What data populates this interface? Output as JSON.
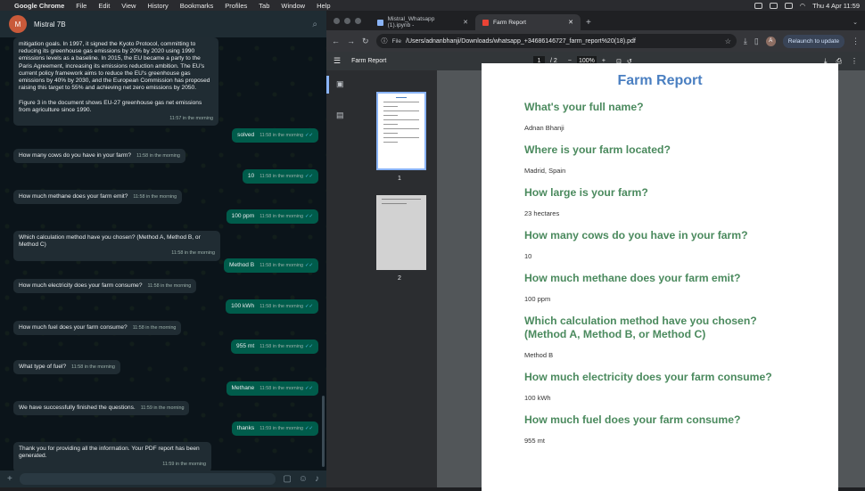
{
  "menubar": {
    "app": "Google Chrome",
    "items": [
      "File",
      "Edit",
      "View",
      "History",
      "Bookmarks",
      "Profiles",
      "Tab",
      "Window",
      "Help"
    ],
    "clock": "Thu 4 Apr  11:59"
  },
  "whatsapp": {
    "avatar_text": "M",
    "contact": "Mistral 7B",
    "messages": [
      {
        "dir": "in",
        "text": "mitigation goals. In 1997, it signed the Kyoto Protocol, committing to reducing its greenhouse gas emissions by 20% by 2020 using 1990 emissions levels as a baseline. In 2015, the EU became a party to the Paris Agreement, increasing its emissions reduction ambition. The EU's current policy framework aims to reduce the EU's greenhouse gas emissions by 40% by 2030, and the European Commission has proposed raising this target to 55% and achieving net zero emissions by 2050.\n\nFigure 3 in the document shows EU-27 greenhouse gas net emissions from agriculture since 1990.",
        "time": "11:57 in the morning"
      },
      {
        "dir": "out",
        "text": "solved",
        "time": "11:58 in the morning"
      },
      {
        "dir": "in",
        "text": "How many cows do you have in your farm?",
        "time": "11:58 in the morning"
      },
      {
        "dir": "out",
        "text": "10",
        "time": "11:58 in the morning"
      },
      {
        "dir": "in",
        "text": "How much methane does your farm emit?",
        "time": "11:58 in the morning"
      },
      {
        "dir": "out",
        "text": "100 ppm",
        "time": "11:58 in the morning"
      },
      {
        "dir": "in",
        "text": "Which calculation method have you chosen? (Method A, Method B, or Method C)",
        "time": "11:58 in the morning"
      },
      {
        "dir": "out",
        "text": "Method B",
        "time": "11:58 in the morning"
      },
      {
        "dir": "in",
        "text": "How much electricity does your farm consume?",
        "time": "11:58 in the morning"
      },
      {
        "dir": "out",
        "text": "100 kWh",
        "time": "11:58 in the morning"
      },
      {
        "dir": "in",
        "text": "How much fuel does your farm consume?",
        "time": "11:58 in the morning"
      },
      {
        "dir": "out",
        "text": "955 mt",
        "time": "11:58 in the morning"
      },
      {
        "dir": "in",
        "text": "What type of fuel?",
        "time": "11:58 in the morning"
      },
      {
        "dir": "out",
        "text": "Methane",
        "time": "11:58 in the morning"
      },
      {
        "dir": "in",
        "text": "We have successfully finished the questions.",
        "time": "11:59 in the morning"
      },
      {
        "dir": "out",
        "text": "thanks",
        "time": "11:59 in the morning"
      },
      {
        "dir": "in",
        "text": "Thank you for providing all the information. Your PDF report has been generated.",
        "time": "11:59 in the morning"
      }
    ]
  },
  "chrome": {
    "tabs": [
      {
        "title": "Mistral_Whatsapp (1).ipynb -",
        "active": false
      },
      {
        "title": "Farm Report",
        "active": true
      }
    ],
    "omnibox_chip": "File",
    "url": "/Users/adnanbhanji/Downloads/whatsapp_+34686146727_farm_report%20(18).pdf",
    "profile": "A",
    "relaunch": "Relaunch to update"
  },
  "pdf": {
    "title": "Farm Report",
    "page_current": "1",
    "page_total": "/ 2",
    "zoom": "100%",
    "thumb_labels": [
      "1",
      "2"
    ],
    "heading": "Farm Report",
    "qa": [
      {
        "q": "What's your full name?",
        "a": "Adnan Bhanji"
      },
      {
        "q": "Where is your farm located?",
        "a": "Madrid, Spain"
      },
      {
        "q": "How large is your farm?",
        "a": "23 hectares"
      },
      {
        "q": "How many cows do you have in your farm?",
        "a": "10"
      },
      {
        "q": "How much methane does your farm emit?",
        "a": "100 ppm"
      },
      {
        "q": "Which calculation method have you chosen? (Method A, Method B, or Method C)",
        "a": "Method B"
      },
      {
        "q": "How much electricity does your farm consume?",
        "a": "100 kWh"
      },
      {
        "q": "How much fuel does your farm consume?",
        "a": "955 mt"
      }
    ]
  }
}
